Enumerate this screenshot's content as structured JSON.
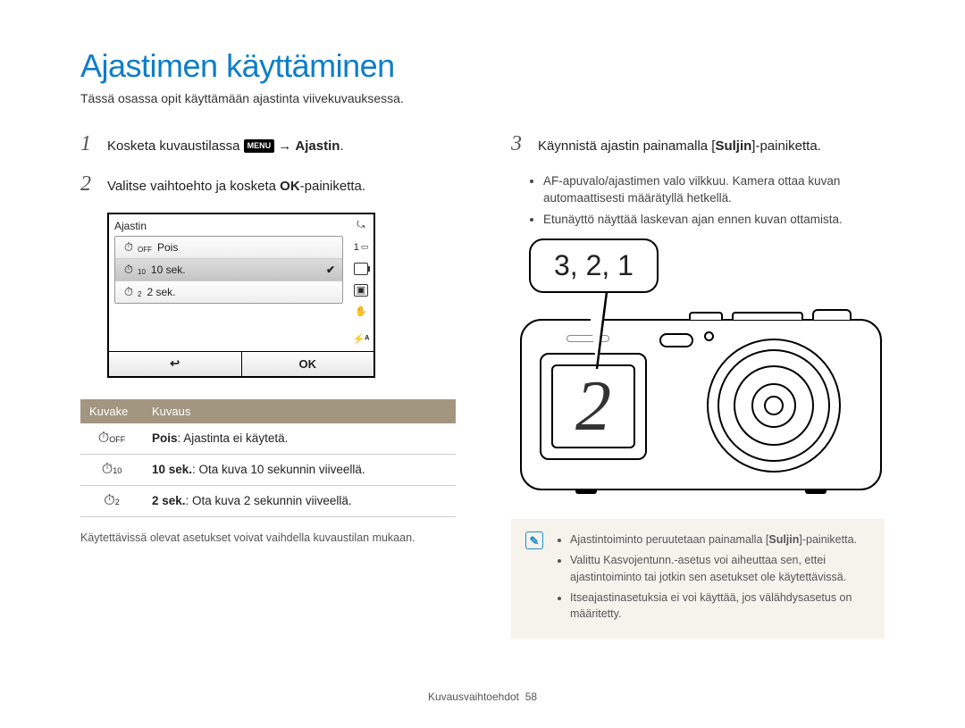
{
  "page": {
    "title": "Ajastimen käyttäminen",
    "subtitle": "Tässä osassa opit käyttämään ajastinta viivekuvauksessa."
  },
  "steps": {
    "s1": {
      "num": "1",
      "pre": "Kosketa kuvaustilassa ",
      "menu_icon": "MENU",
      "arrow": " → ",
      "bold": "Ajastin",
      "after": "."
    },
    "s2": {
      "num": "2",
      "pre": "Valitse vaihtoehto ja kosketa ",
      "ok": "OK",
      "after": "-painiketta."
    },
    "s3": {
      "num": "3",
      "pre": "Käynnistä ajastin painamalla [",
      "bold": "Suljin",
      "after": "]-painiketta."
    }
  },
  "screen": {
    "title": "Ajastin",
    "options": [
      {
        "icon": "⏱",
        "sub": "OFF",
        "label": "Pois",
        "selected": false
      },
      {
        "icon": "⏱",
        "sub": "10",
        "label": "10 sek.",
        "selected": true
      },
      {
        "icon": "⏱",
        "sub": "2",
        "label": "2 sek.",
        "selected": false
      }
    ],
    "back": "↩",
    "ok": "OK",
    "side_top": "⤿",
    "side_num": "1"
  },
  "table": {
    "head_icon": "Kuvake",
    "head_desc": "Kuvaus",
    "rows": [
      {
        "icon": "⏱",
        "sub": "OFF",
        "bold": "Pois",
        "text": ": Ajastinta ei käytetä."
      },
      {
        "icon": "⏱",
        "sub": "10",
        "bold": "10 sek.",
        "text": ": Ota kuva 10 sekunnin viiveellä."
      },
      {
        "icon": "⏱",
        "sub": "2",
        "bold": "2 sek.",
        "text": ": Ota kuva 2 sekunnin viiveellä."
      }
    ]
  },
  "left_footnote": "Käytettävissä olevat asetukset voivat vaihdella kuvaustilan mukaan.",
  "right_bullets": [
    "AF-apuvalo/ajastimen valo vilkkuu. Kamera ottaa kuvan automaattisesti määrätyllä hetkellä.",
    "Etunäyttö näyttää laskevan ajan ennen kuvan ottamista."
  ],
  "bubble": "3, 2, 1",
  "countdown_digit": "2",
  "notes": [
    {
      "pre": "Ajastintoiminto peruutetaan painamalla [",
      "bold": "Suljin",
      "post": "]-painiketta."
    },
    {
      "pre": "Valittu Kasvojentunn.-asetus voi aiheuttaa sen, ettei ajastintoiminto tai jotkin sen asetukset ole käytettävissä.",
      "bold": "",
      "post": ""
    },
    {
      "pre": "Itseajastinasetuksia ei voi käyttää, jos välähdysasetus on määritetty.",
      "bold": "",
      "post": ""
    }
  ],
  "footer": {
    "section": "Kuvausvaihtoehdot",
    "page": "58"
  }
}
